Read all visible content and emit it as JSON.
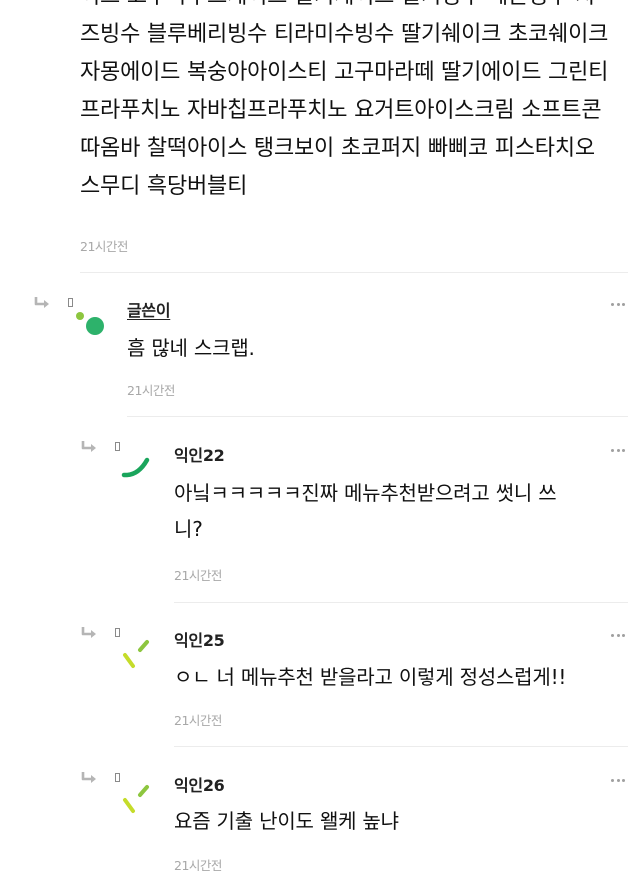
{
  "post": {
    "body_lines": [
      "이크 고구마무스케이크 딸기케이크 딸기빙수 메론빙수 치",
      "즈빙수 블루베리빙수 티라미수빙수 딸기쉐이크 초코쉐이크",
      "자몽에이드 복숭아아이스티 고구마라떼 딸기에이드 그린티",
      "프라푸치노 자바칩프라푸치노 요거트아이스크림 소프트콘",
      "따옴바 찰떡아이스 탱크보이 초코퍼지 빠삐코 피스타치오",
      "스무디 흑당버블티"
    ],
    "time": "21시간전"
  },
  "comments": [
    {
      "author": "글쓴이",
      "text_lines": [
        "흠 많네 스크랩."
      ],
      "time": "21시간전",
      "avatar_colors": [
        "#8dc63f",
        "#2db26b"
      ]
    },
    {
      "author": "익인22",
      "text_lines": [
        "아닠ㅋㅋㅋㅋㅋ진짜 메뉴추천받으려고 썻니 쓰",
        "니?"
      ],
      "time": "21시간전",
      "avatar_colors": [
        "#1aa55c"
      ]
    },
    {
      "author": "익인25",
      "text_lines": [
        "ㅇㄴ 너 메뉴추천 받을라고 이렇게 정성스럽게!!"
      ],
      "time": "21시간전",
      "avatar_colors": [
        "#c5dc2a",
        "#8dc63f"
      ]
    },
    {
      "author": "익인26",
      "text_lines": [
        "요즘 기출 난이도 왤케 높냐"
      ],
      "time": "21시간전",
      "avatar_colors": [
        "#c5dc2a",
        "#8dc63f"
      ]
    }
  ],
  "icons": {
    "reply": "reply-arrow-icon",
    "more": "more-options-icon"
  }
}
